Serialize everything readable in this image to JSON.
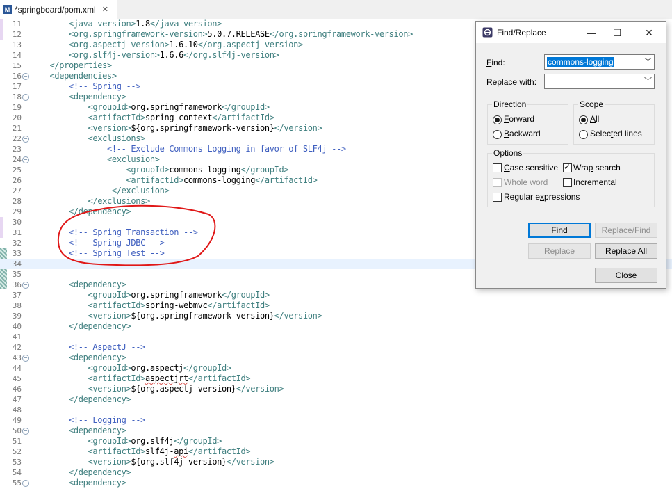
{
  "tab": {
    "title": "*springboard/pom.xml",
    "icon": "maven-file-icon",
    "file_icon_letter": "M"
  },
  "editor": {
    "current_line": 34,
    "lines": [
      {
        "n": "11",
        "html": "        <span class=\"tg\">&lt;java-version&gt;</span>1.8<span class=\"tg\">&lt;/java-version&gt;</span>"
      },
      {
        "n": "12",
        "html": "        <span class=\"tg\">&lt;org.springframework-version&gt;</span>5.0.7.RELEASE<span class=\"tg\">&lt;/org.springframework-version&gt;</span>"
      },
      {
        "n": "13",
        "html": "        <span class=\"tg\">&lt;org.aspectj-version&gt;</span>1.6.10<span class=\"tg\">&lt;/org.aspectj-version&gt;</span>"
      },
      {
        "n": "14",
        "html": "        <span class=\"tg\">&lt;org.slf4j-version&gt;</span>1.6.6<span class=\"tg\">&lt;/org.slf4j-version&gt;</span>"
      },
      {
        "n": "15",
        "html": "    <span class=\"tg\">&lt;/properties&gt;</span>"
      },
      {
        "n": "16",
        "fold": true,
        "html": "    <span class=\"tg\">&lt;dependencies&gt;</span>"
      },
      {
        "n": "17",
        "html": "        <span class=\"cm\">&lt;!-- Spring --&gt;</span>"
      },
      {
        "n": "18",
        "fold": true,
        "html": "        <span class=\"tg\">&lt;dependency&gt;</span>"
      },
      {
        "n": "19",
        "html": "            <span class=\"tg\">&lt;groupId&gt;</span>org.springframework<span class=\"tg\">&lt;/groupId&gt;</span>"
      },
      {
        "n": "20",
        "html": "            <span class=\"tg\">&lt;artifactId&gt;</span>spring-context<span class=\"tg\">&lt;/artifactId&gt;</span>"
      },
      {
        "n": "21",
        "html": "            <span class=\"tg\">&lt;version&gt;</span>${org.springframework-version}<span class=\"tg\">&lt;/version&gt;</span>"
      },
      {
        "n": "22",
        "fold": true,
        "html": "            <span class=\"tg\">&lt;exclusions&gt;</span>"
      },
      {
        "n": "23",
        "html": "                <span class=\"cm\">&lt;!-- Exclude Commons Logging in favor of SLF4j --&gt;</span>"
      },
      {
        "n": "24",
        "fold": true,
        "html": "                <span class=\"tg\">&lt;exclusion&gt;</span>"
      },
      {
        "n": "25",
        "html": "                    <span class=\"tg\">&lt;groupId&gt;</span>commons-logging<span class=\"tg\">&lt;/groupId&gt;</span>"
      },
      {
        "n": "26",
        "html": "                    <span class=\"tg\">&lt;artifactId&gt;</span>commons-logging<span class=\"tg\">&lt;/artifactId&gt;</span>"
      },
      {
        "n": "27",
        "html": "                 <span class=\"tg\">&lt;/exclusion&gt;</span>"
      },
      {
        "n": "28",
        "html": "            <span class=\"tg\">&lt;/exclusions&gt;</span>"
      },
      {
        "n": "29",
        "html": "        <span class=\"tg\">&lt;/dependency&gt;</span>"
      },
      {
        "n": "30",
        "html": ""
      },
      {
        "n": "31",
        "html": "        <span class=\"cm\">&lt;!-- Spring Transaction --&gt;</span>"
      },
      {
        "n": "32",
        "html": "        <span class=\"cm\">&lt;!-- Spring JDBC --&gt;</span>"
      },
      {
        "n": "33",
        "html": "        <span class=\"cm\">&lt;!-- Spring Test --&gt;</span>"
      },
      {
        "n": "34",
        "html": ""
      },
      {
        "n": "35",
        "html": ""
      },
      {
        "n": "36",
        "fold": true,
        "html": "        <span class=\"tg\">&lt;dependency&gt;</span>"
      },
      {
        "n": "37",
        "html": "            <span class=\"tg\">&lt;groupId&gt;</span>org.springframework<span class=\"tg\">&lt;/groupId&gt;</span>"
      },
      {
        "n": "38",
        "html": "            <span class=\"tg\">&lt;artifactId&gt;</span>spring-webmvc<span class=\"tg\">&lt;/artifactId&gt;</span>"
      },
      {
        "n": "39",
        "html": "            <span class=\"tg\">&lt;version&gt;</span>${org.springframework-version}<span class=\"tg\">&lt;/version&gt;</span>"
      },
      {
        "n": "40",
        "html": "        <span class=\"tg\">&lt;/dependency&gt;</span>"
      },
      {
        "n": "41",
        "html": ""
      },
      {
        "n": "42",
        "html": "        <span class=\"cm\">&lt;!-- AspectJ --&gt;</span>"
      },
      {
        "n": "43",
        "fold": true,
        "html": "        <span class=\"tg\">&lt;dependency&gt;</span>"
      },
      {
        "n": "44",
        "html": "            <span class=\"tg\">&lt;groupId&gt;</span>org.aspectj<span class=\"tg\">&lt;/groupId&gt;</span>"
      },
      {
        "n": "45",
        "html": "            <span class=\"tg\">&lt;artifactId&gt;</span><span class=\"sq\">aspectjrt</span><span class=\"tg\">&lt;/artifactId&gt;</span>"
      },
      {
        "n": "46",
        "html": "            <span class=\"tg\">&lt;version&gt;</span>${org.aspectj-version}<span class=\"tg\">&lt;/version&gt;</span>"
      },
      {
        "n": "47",
        "html": "        <span class=\"tg\">&lt;/dependency&gt;</span>"
      },
      {
        "n": "48",
        "html": ""
      },
      {
        "n": "49",
        "html": "        <span class=\"cm\">&lt;!-- Logging --&gt;</span>"
      },
      {
        "n": "50",
        "fold": true,
        "html": "        <span class=\"tg\">&lt;dependency&gt;</span>"
      },
      {
        "n": "51",
        "html": "            <span class=\"tg\">&lt;groupId&gt;</span>org.slf4j<span class=\"tg\">&lt;/groupId&gt;</span>"
      },
      {
        "n": "52",
        "html": "            <span class=\"tg\">&lt;artifactId&gt;</span>slf4j-<span class=\"sq\">api</span><span class=\"tg\">&lt;/artifactId&gt;</span>"
      },
      {
        "n": "53",
        "html": "            <span class=\"tg\">&lt;version&gt;</span>${org.slf4j-version}<span class=\"tg\">&lt;/version&gt;</span>"
      },
      {
        "n": "54",
        "html": "        <span class=\"tg\">&lt;/dependency&gt;</span>"
      },
      {
        "n": "55",
        "fold": true,
        "html": "        <span class=\"tg\">&lt;dependency&gt;</span>"
      }
    ]
  },
  "dialog": {
    "title": "Find/Replace",
    "find_value": "commons-logging",
    "replace_value": "",
    "direction": {
      "title": "Direction",
      "options": [
        "Forward",
        "Backward"
      ],
      "selected": "Forward"
    },
    "scope": {
      "title": "Scope",
      "options": [
        "All",
        "Selected lines"
      ],
      "selected": "All"
    },
    "options": {
      "title": "Options",
      "case_sensitive": false,
      "wrap_search": true,
      "whole_word": false,
      "incremental": false,
      "regular_expressions": false
    }
  },
  "colors": {
    "tag": "#3f7f7f",
    "comment": "#3f5fbf",
    "annotation": "#e01818",
    "selection": "#0078d7"
  }
}
